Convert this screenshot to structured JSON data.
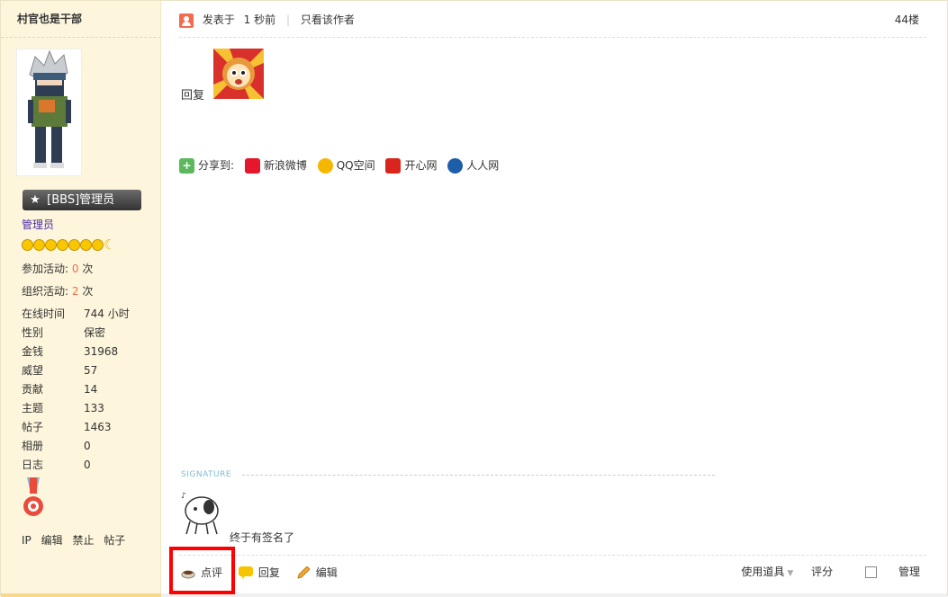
{
  "author": {
    "name": "村官也是干部",
    "badge": "[BBS]管理员",
    "group": "管理员",
    "activities": [
      {
        "label": "参加活动: ",
        "value": "0",
        "unit": " 次"
      },
      {
        "label": "组织活动: ",
        "value": "2",
        "unit": " 次"
      }
    ],
    "stats": [
      {
        "label": "在线时间",
        "value": "744 小时"
      },
      {
        "label": "性别",
        "value": "保密"
      },
      {
        "label": "金钱",
        "value": "31968"
      },
      {
        "label": "威望",
        "value": "57"
      },
      {
        "label": "贡献",
        "value": "14"
      },
      {
        "label": "主题",
        "value": "133"
      },
      {
        "label": "帖子",
        "value": "1463"
      },
      {
        "label": "相册",
        "value": "0"
      },
      {
        "label": "日志",
        "value": "0"
      }
    ],
    "admin_links": [
      "IP",
      "编辑",
      "禁止",
      "帖子"
    ]
  },
  "post": {
    "posted_prefix": "发表于",
    "posted_time": "1 秒前",
    "only_author": "只看该作者",
    "floor": "44楼",
    "content": "回复",
    "share_label": "分享到:",
    "share_targets": [
      {
        "name": "新浪微博",
        "color": "#e6162d"
      },
      {
        "name": "QQ空间",
        "color": "#f6b700"
      },
      {
        "name": "开心网",
        "color": "#d9251d"
      },
      {
        "name": "人人网",
        "color": "#1c5fa8"
      }
    ],
    "signature_label": "SIGNATURE",
    "signature_text": "终于有签名了"
  },
  "actions": {
    "comment": "点评",
    "reply": "回复",
    "edit": "编辑",
    "tools": "使用道具",
    "rate": "评分",
    "manage": "管理"
  },
  "colors": {
    "sidebar_bg": "#fdf6dc",
    "highlight": "#ff0000",
    "number_accent": "#f26c4f",
    "group_color": "#4b2aa5"
  }
}
